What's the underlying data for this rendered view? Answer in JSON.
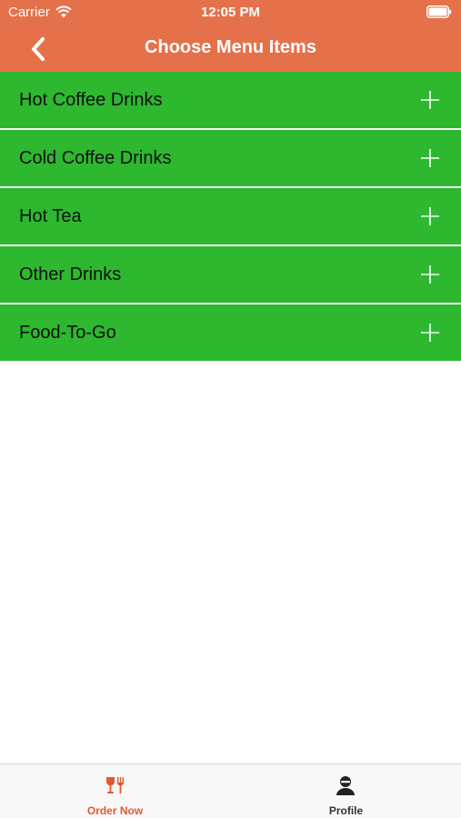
{
  "status_bar": {
    "carrier": "Carrier",
    "time": "12:05 PM"
  },
  "nav": {
    "title": "Choose Menu Items",
    "back_icon": "chevron-left-icon"
  },
  "menu": {
    "items": [
      {
        "label": "Hot Coffee Drinks",
        "icon": "plus-icon"
      },
      {
        "label": "Cold Coffee Drinks",
        "icon": "plus-icon"
      },
      {
        "label": "Hot Tea",
        "icon": "plus-icon"
      },
      {
        "label": "Other Drinks",
        "icon": "plus-icon"
      },
      {
        "label": "Food-To-Go",
        "icon": "plus-icon"
      }
    ]
  },
  "tabs": [
    {
      "label": "Order Now",
      "icon": "glass-fork-icon",
      "selected": true
    },
    {
      "label": "Profile",
      "icon": "person-icon",
      "selected": false
    }
  ],
  "colors": {
    "header": "#E5714A",
    "menu_item": "#2DB82F",
    "tab_selected": "#E5582F",
    "tab_unselected": "#333333"
  }
}
